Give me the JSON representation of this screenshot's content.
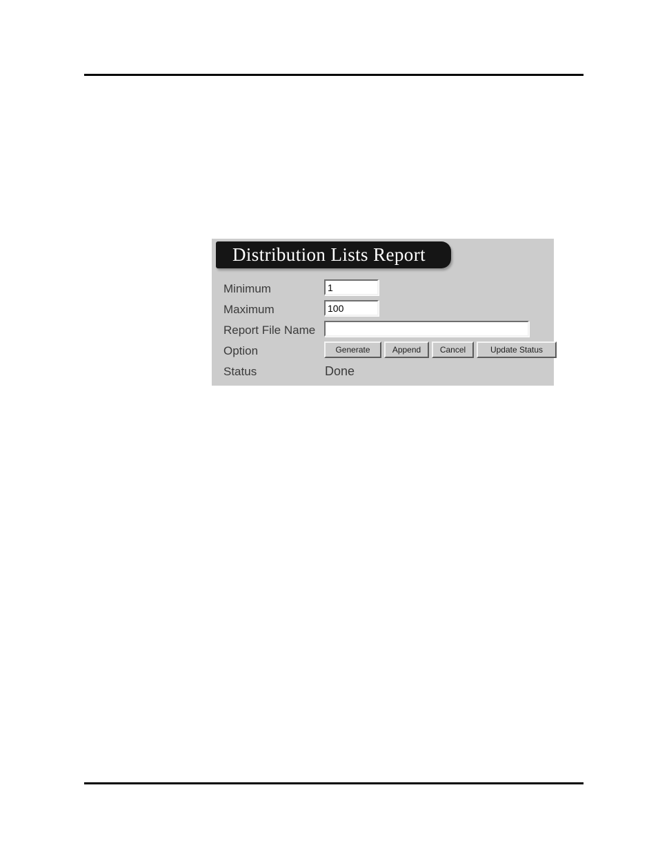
{
  "page": {
    "background_color": "#ffffff",
    "rule_color": "#000000"
  },
  "dialog": {
    "title": "Distribution Lists Report",
    "panel_color": "#cccccc",
    "banner_color": "#151515",
    "banner_text_color": "#ffffff",
    "rows": {
      "minimum": {
        "label": "Minimum",
        "value": "1",
        "placeholder": ""
      },
      "maximum": {
        "label": "Maximum",
        "value": "100",
        "placeholder": ""
      },
      "report_file_name": {
        "label": "Report File Name",
        "value": "",
        "placeholder": ""
      },
      "option": {
        "label": "Option",
        "buttons": [
          {
            "label": "Generate"
          },
          {
            "label": "Append"
          },
          {
            "label": "Cancel"
          },
          {
            "label": "Update Status"
          }
        ]
      },
      "status": {
        "label": "Status",
        "value": "Done"
      }
    }
  }
}
